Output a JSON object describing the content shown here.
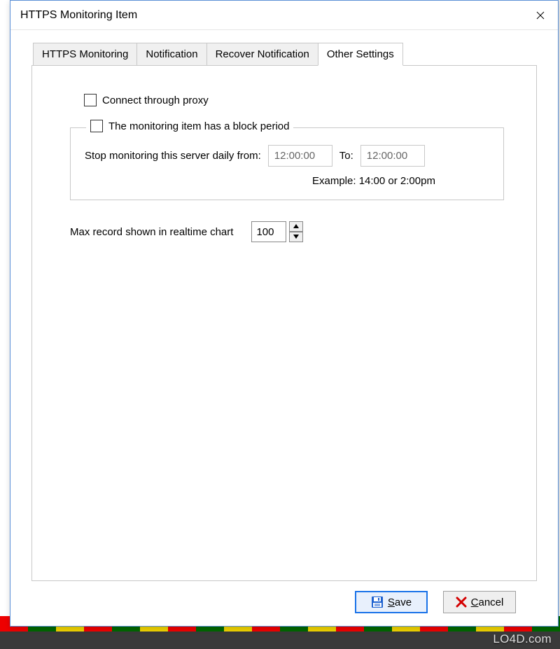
{
  "window": {
    "title": "HTTPS Monitoring Item"
  },
  "tabs": [
    {
      "label": "HTTPS Monitoring"
    },
    {
      "label": "Notification"
    },
    {
      "label": "Recover Notification"
    },
    {
      "label": "Other Settings"
    }
  ],
  "settings": {
    "proxy_label": "Connect through proxy",
    "block_period_label": "The monitoring item has a block period",
    "stop_label": "Stop monitoring this server daily from:",
    "from_value": "12:00:00",
    "to_label": "To:",
    "to_value": "12:00:00",
    "example_label": "Example: 14:00 or 2:00pm",
    "max_record_label": "Max record shown in realtime chart",
    "max_record_value": "100"
  },
  "buttons": {
    "save": "Save",
    "cancel": "Cancel"
  },
  "watermark": "LO4D.com"
}
